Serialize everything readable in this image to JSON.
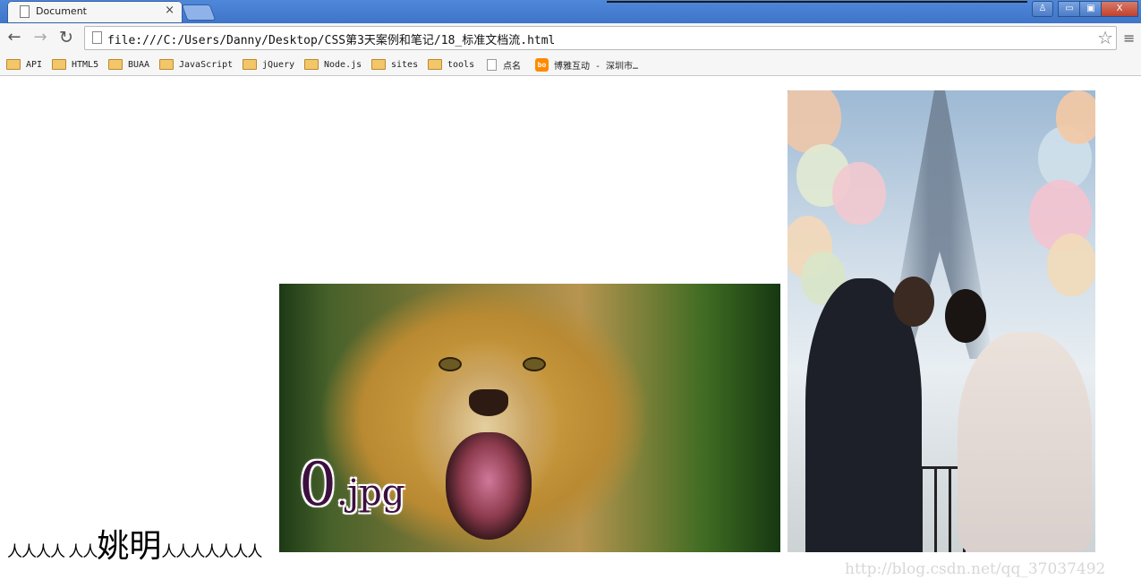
{
  "browser": {
    "tab": {
      "title": "Document",
      "close_glyph": "×"
    },
    "window_buttons": {
      "user": "♙",
      "minimize": "▭",
      "maximize": "▣",
      "close": "X"
    },
    "toolbar": {
      "back_glyph": "←",
      "forward_glyph": "→",
      "reload_glyph": "↻",
      "url": "file:///C:/Users/Danny/Desktop/CSS第3天案例和笔记/18_标准文档流.html",
      "star_glyph": "☆",
      "menu_glyph": "≡"
    },
    "bookmarks": [
      {
        "label": "API",
        "icon": "folder-icon"
      },
      {
        "label": "HTML5",
        "icon": "folder-icon"
      },
      {
        "label": "BUAA",
        "icon": "folder-icon"
      },
      {
        "label": "JavaScript",
        "icon": "folder-icon"
      },
      {
        "label": "jQuery",
        "icon": "folder-icon"
      },
      {
        "label": "Node.js",
        "icon": "folder-icon"
      },
      {
        "label": "sites",
        "icon": "folder-icon"
      },
      {
        "label": "tools",
        "icon": "folder-icon"
      },
      {
        "label": "点名",
        "icon": "file-icon"
      },
      {
        "label": "博雅互动 - 深圳市…",
        "icon": "boya-logo-icon",
        "logo_text": "bo"
      }
    ]
  },
  "page": {
    "text_before": "人人人人 人人",
    "name": "姚明",
    "text_after": "人人人人人人人",
    "lion_image": {
      "caption_number": "0",
      "caption_ext": ".jpg"
    },
    "watermark": "http://blog.csdn.net/qq_37037492"
  },
  "colors": {
    "titlebar": "#4f87d9",
    "caption_text": "#3d0f3f",
    "watermark": "#d7d7d7"
  }
}
